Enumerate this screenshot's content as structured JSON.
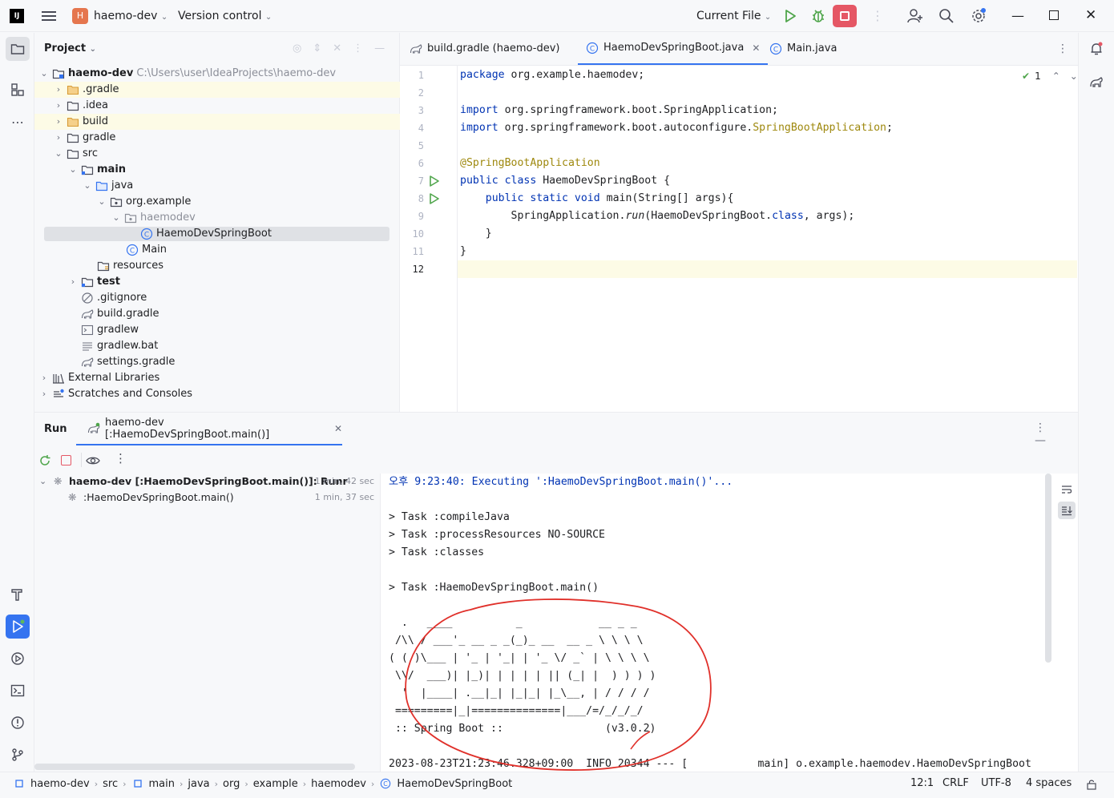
{
  "titlebar": {
    "logo": "IJ",
    "project_badge": "H",
    "project_name": "haemo-dev",
    "vcs": "Version control",
    "run_config": "Current File"
  },
  "project_panel": {
    "title": "Project",
    "root_name": "haemo-dev",
    "root_path": "C:\\Users\\user\\IdeaProjects\\haemo-dev",
    "items": [
      {
        "label": ".gradle"
      },
      {
        "label": ".idea"
      },
      {
        "label": "build"
      },
      {
        "label": "gradle"
      },
      {
        "label": "src"
      },
      {
        "label": "main"
      },
      {
        "label": "java"
      },
      {
        "label": "org.example"
      },
      {
        "label": "haemodev"
      },
      {
        "label": "HaemoDevSpringBoot"
      },
      {
        "label": "Main"
      },
      {
        "label": "resources"
      },
      {
        "label": "test"
      },
      {
        "label": ".gitignore"
      },
      {
        "label": "build.gradle"
      },
      {
        "label": "gradlew"
      },
      {
        "label": "gradlew.bat"
      },
      {
        "label": "settings.gradle"
      },
      {
        "label": "External Libraries"
      },
      {
        "label": "Scratches and Consoles"
      }
    ]
  },
  "editor": {
    "tabs": [
      {
        "label": "build.gradle (haemo-dev)"
      },
      {
        "label": "HaemoDevSpringBoot.java"
      },
      {
        "label": "Main.java"
      }
    ],
    "inspection_count": "1",
    "line_numbers": [
      "1",
      "2",
      "3",
      "4",
      "5",
      "6",
      "7",
      "8",
      "9",
      "10",
      "11",
      "12"
    ],
    "code": {
      "l1_kw": "package",
      "l1_rest": " org.example.haemodev;",
      "l3_kw": "import",
      "l3_rest": " org.springframework.boot.SpringApplication;",
      "l4_kw": "import",
      "l4_rest": " org.springframework.boot.autoconfigure.",
      "l4_ann": "SpringBootApplication",
      "l4_end": ";",
      "l6_ann": "@SpringBootApplication",
      "l7_kw": "public class",
      "l7_rest": " HaemoDevSpringBoot {",
      "l8_indent": "    ",
      "l8_kw": "public static void",
      "l8_rest": " main(String[] args){",
      "l9_a": "        SpringApplication.",
      "l9_b": "run",
      "l9_c": "(HaemoDevSpringBoot.",
      "l9_d": "class",
      "l9_e": ", args);",
      "l10": "    }",
      "l11": "}"
    }
  },
  "run_panel": {
    "title": "Run",
    "tab_label": "haemo-dev [:HaemoDevSpringBoot.main()]",
    "tree": [
      {
        "label": "haemo-dev [:HaemoDevSpringBoot.main()]: Runr",
        "time": "1 min, 42 sec"
      },
      {
        "label": ":HaemoDevSpringBoot.main()",
        "time": "1 min, 37 sec"
      }
    ],
    "console": [
      "오후 9:23:40: Executing ':HaemoDevSpringBoot.main()'...",
      "",
      "> Task :compileJava",
      "> Task :processResources NO-SOURCE",
      "> Task :classes",
      "",
      "> Task :HaemoDevSpringBoot.main()",
      "",
      "  .   ____          _            __ _ _",
      " /\\\\ / ___'_ __ _ _(_)_ __  __ _ \\ \\ \\ \\",
      "( ( )\\___ | '_ | '_| | '_ \\/ _` | \\ \\ \\ \\",
      " \\\\/  ___)| |_)| | | | | || (_| |  ) ) ) )",
      "  '  |____| .__|_| |_|_| |_\\__, | / / / /",
      " =========|_|==============|___/=/_/_/_/",
      " :: Spring Boot ::                (v3.0.2)",
      "",
      "2023-08-23T21:23:46.328+09:00  INFO 20344 --- [           main] o.example.haemodev.HaemoDevSpringBoot"
    ]
  },
  "statusbar": {
    "crumbs": [
      "haemo-dev",
      "src",
      "main",
      "java",
      "org",
      "example",
      "haemodev",
      "HaemoDevSpringBoot"
    ],
    "position": "12:1",
    "line_sep": "CRLF",
    "encoding": "UTF-8",
    "indent": "4 spaces"
  },
  "colors": {
    "accent": "#3574f0",
    "stop": "#e55765",
    "run_green": "#4fa54b",
    "annotation_circle": "#e0302a"
  }
}
